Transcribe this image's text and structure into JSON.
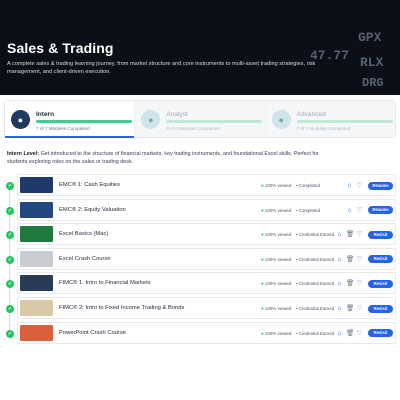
{
  "hero": {
    "title": "Sales & Trading",
    "description": "A complete sales & trading learning journey, from market structure and core instruments to multi-asset trading strategies, risk management, and client-driven execution.",
    "ticker": [
      "GPX",
      "47.77",
      "RLX",
      "DRG"
    ]
  },
  "levels": [
    {
      "name": "Intern",
      "count_text": "7 of 7 Modules Completed",
      "progress": 1.0,
      "icon": "intern-icon",
      "active": true
    },
    {
      "name": "Analyst",
      "count_text": "6 of 6 Modules Completed",
      "progress": 1.0,
      "icon": "analyst-icon",
      "active": false
    },
    {
      "name": "Advanced",
      "count_text": "7 of 7 Modules Completed",
      "progress": 1.0,
      "icon": "advanced-icon",
      "active": false
    }
  ],
  "intro": {
    "label": "Intern Level:",
    "text": "Get introduced to the structure of financial markets, key trading instruments, and foundational Excel skills. Perfect for students exploring roles on the sales or trading desk."
  },
  "modules": [
    {
      "title": "EMC® 1: Cash Equities",
      "viewed": "100% viewed",
      "status": "Completed",
      "action": "Resume",
      "has_trash": false,
      "thumb_color": "#1d3a6b"
    },
    {
      "title": "EMC® 2: Equity Valuation",
      "viewed": "100% viewed",
      "status": "Completed",
      "action": "Resume",
      "has_trash": false,
      "thumb_color": "#22497e"
    },
    {
      "title": "Excel Basics (Mac)",
      "viewed": "100% viewed",
      "status": "Credential Earned",
      "action": "Revisit",
      "has_trash": true,
      "thumb_color": "#1f7a3f"
    },
    {
      "title": "Excel Crash Course",
      "viewed": "100% viewed",
      "status": "Credential Earned",
      "action": "Revisit",
      "has_trash": true,
      "thumb_color": "#c9ccd1"
    },
    {
      "title": "FIMC® 1: Intro to Financial Markets",
      "viewed": "100% viewed",
      "status": "Credential Earned",
      "action": "Revisit",
      "has_trash": true,
      "thumb_color": "#2a3b55"
    },
    {
      "title": "FIMC® 2: Intro to Fixed Income Trading & Bonds",
      "viewed": "100% viewed",
      "status": "Credential Earned",
      "action": "Revisit",
      "has_trash": true,
      "thumb_color": "#d9c9a6"
    },
    {
      "title": "PowerPoint Crash Course",
      "viewed": "100% viewed",
      "status": "Credential Earned",
      "action": "Revisit",
      "has_trash": true,
      "thumb_color": "#d9603a"
    }
  ],
  "colors": {
    "accent": "#2563eb",
    "success": "#22c55e",
    "hero_bg": "#0b0f17"
  }
}
